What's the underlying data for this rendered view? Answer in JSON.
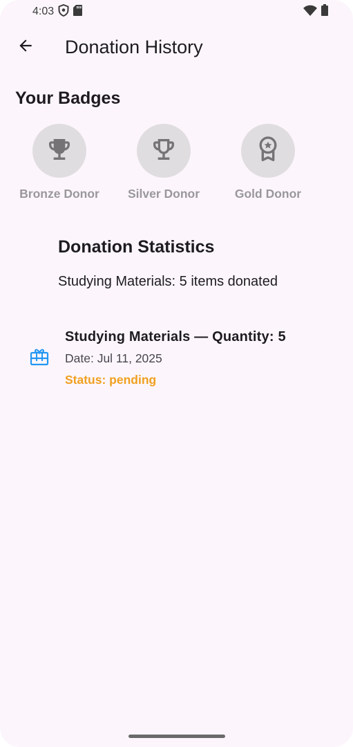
{
  "status_bar": {
    "time": "4:03",
    "icons": [
      "shield-icon",
      "sd-card-icon",
      "wifi-icon",
      "battery-icon"
    ]
  },
  "app_bar": {
    "back_icon": "arrow-back-icon",
    "title": "Donation History"
  },
  "badges_section": {
    "title": "Your Badges",
    "items": [
      {
        "label": "Bronze Donor",
        "icon": "trophy-icon"
      },
      {
        "label": "Silver Donor",
        "icon": "trophy-outline-icon"
      },
      {
        "label": "Gold Donor",
        "icon": "award-ribbon-icon"
      }
    ]
  },
  "stats_section": {
    "title": "Donation Statistics",
    "lines": [
      "Studying Materials: 5 items donated"
    ]
  },
  "history": [
    {
      "icon": "gift-card-icon",
      "title": "Studying Materials — Quantity: 5",
      "date": "Date: Jul 11, 2025",
      "status": "Status: pending"
    }
  ],
  "colors": {
    "background": "#fcf6fc",
    "badge_circle": "#e0dde0",
    "badge_icon": "#757375",
    "badge_label": "#9a979a",
    "status_pending": "#f0a020",
    "gift_icon": "#2196f3"
  }
}
